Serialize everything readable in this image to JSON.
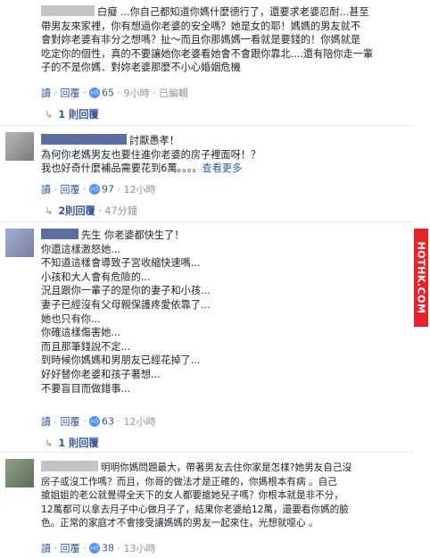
{
  "comments": [
    {
      "text_lines": [
        "白癡 ...你自己都知道你媽什麼德行了，還要求老婆忍耐...甚至",
        "帶男友來家裡，你有想過你老婆的安全嗎？她是女的耶！媽媽的男友就不",
        "會對妳老婆有非分之想嗎？扯～而且你那媽媽一看就是要錢的！你媽就是",
        "吃定你的個性，真的不要讓她你老婆看她會不會跟你靠北....還有陪你走一輩",
        "子的不是你媽．對妳老婆那麼不小心婚姻危機"
      ],
      "actions": {
        "reply": "讀",
        "reply_action": "回覆",
        "likes": "65",
        "time": "9小時",
        "edited": "已編輯"
      },
      "replies_label": "1 則回覆"
    },
    {
      "text_lines": [
        "討厭愚孝！",
        "為何你老媽男友也要住進你老婆的房子裡面呀！？",
        "我也好奇什麼補品需要花到6萬。。。。"
      ],
      "more": "查看更多",
      "actions": {
        "reply": "讀",
        "reply_action": "回覆",
        "likes": "97",
        "time": "12小時"
      },
      "replies_label": "2則回覆",
      "replies_time": "47分鐘"
    },
    {
      "text_lines": [
        "先生 你老婆都快生了！",
        "你還這樣激怒她...",
        "不知道這樣會導致子宮收縮快速嗎...",
        "小孩和大人會有危險的...",
        "況且跟你一輩子的是你的妻子和小孩...",
        "妻子已經沒有父母親保護疼愛依靠了...",
        "她也只有你...",
        "你確這樣傷害她...",
        "而且那筆錢說不定...",
        "到時候你媽媽和男朋友已經花掉了...",
        "好好替你老婆和孩子著想...",
        "不要盲目而做錯事..."
      ],
      "actions": {
        "reply": "讀",
        "reply_action": "回覆",
        "likes": "63",
        "time": "12小時"
      },
      "replies_label": "1 則回覆"
    },
    {
      "text_lines": [
        "明明你媽問題最大，帶著男友去住你家是怎樣?她男友自己沒",
        "房子或沒工作嗎？而且，你哥的做法才是正確的，你媽根本有病 。自己",
        "搶姐姐的老公就覺得全天下的女人都要搶她兒子嗎？你根本就是非不分，",
        "12萬都可以拿去月子中心做月子了，結果你老婆給12萬，還要看你媽的臉",
        "色。正常的家庭才不會接受讓媽媽的男友一起來住，光想就噁心 。"
      ],
      "actions": {
        "reply": "讀",
        "reply_action": "回覆",
        "likes": "38",
        "time": "13小時"
      }
    }
  ],
  "watermark": "HOTHK.COM",
  "colors": {
    "link": "#365899",
    "meta": "#90949c",
    "like": "#5890ff",
    "watermark": "#e8232c"
  }
}
